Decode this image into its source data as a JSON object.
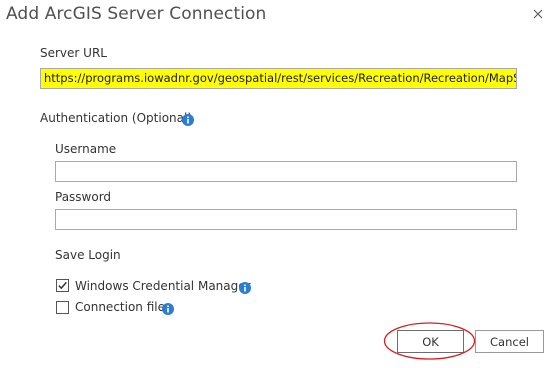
{
  "dialog": {
    "title": "Add ArcGIS Server Connection",
    "close_icon": "close-icon"
  },
  "server_url": {
    "label": "Server URL",
    "value": "https://programs.iowadnr.gov/geospatial/rest/services/Recreation/Recreation/MapServer",
    "highlight_color": "#ffff00"
  },
  "authentication": {
    "label": "Authentication (Optional)",
    "info_icon": "info-icon",
    "username_label": "Username",
    "username_value": "",
    "password_label": "Password",
    "password_value": ""
  },
  "save_login": {
    "label": "Save Login",
    "windows_credential_manager": {
      "label": "Windows Credential Manager",
      "checked": true
    },
    "connection_file": {
      "label": "Connection file",
      "checked": false
    }
  },
  "buttons": {
    "ok_label": "OK",
    "cancel_label": "Cancel"
  },
  "colors": {
    "info_icon": "#2b7cd3",
    "annotation_ellipse": "#d42020"
  }
}
